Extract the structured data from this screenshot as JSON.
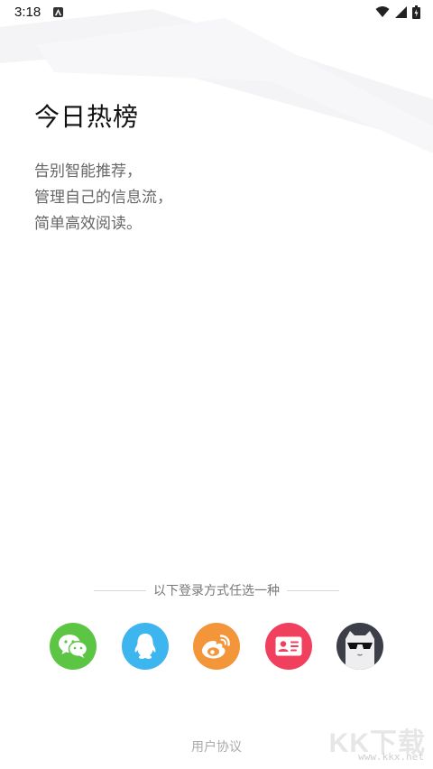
{
  "status_bar": {
    "time": "3:18",
    "notification_icon": "a-notification-icon",
    "icons": [
      "wifi-icon",
      "cellular-signal-icon",
      "battery-icon"
    ]
  },
  "hero": {
    "title": "今日热榜",
    "description_lines": [
      "告别智能推荐，",
      "管理自己的信息流，",
      "简单高效阅读。"
    ]
  },
  "login": {
    "divider_text": "以下登录方式任选一种",
    "options": [
      {
        "name": "wechat",
        "icon": "wechat-icon",
        "color": "#5dc544"
      },
      {
        "name": "qq",
        "icon": "qq-penguin-icon",
        "color": "#3db5ef"
      },
      {
        "name": "weibo",
        "icon": "weibo-icon",
        "color": "#f39539"
      },
      {
        "name": "id-card",
        "icon": "id-card-icon",
        "color": "#f0405d"
      },
      {
        "name": "anonymous",
        "icon": "sunglasses-cat-icon",
        "color": "#3c3f48"
      }
    ]
  },
  "footer": {
    "agreement": "用户协议"
  },
  "watermark": {
    "main": "KK下载",
    "sub": "www.kkx.net"
  }
}
